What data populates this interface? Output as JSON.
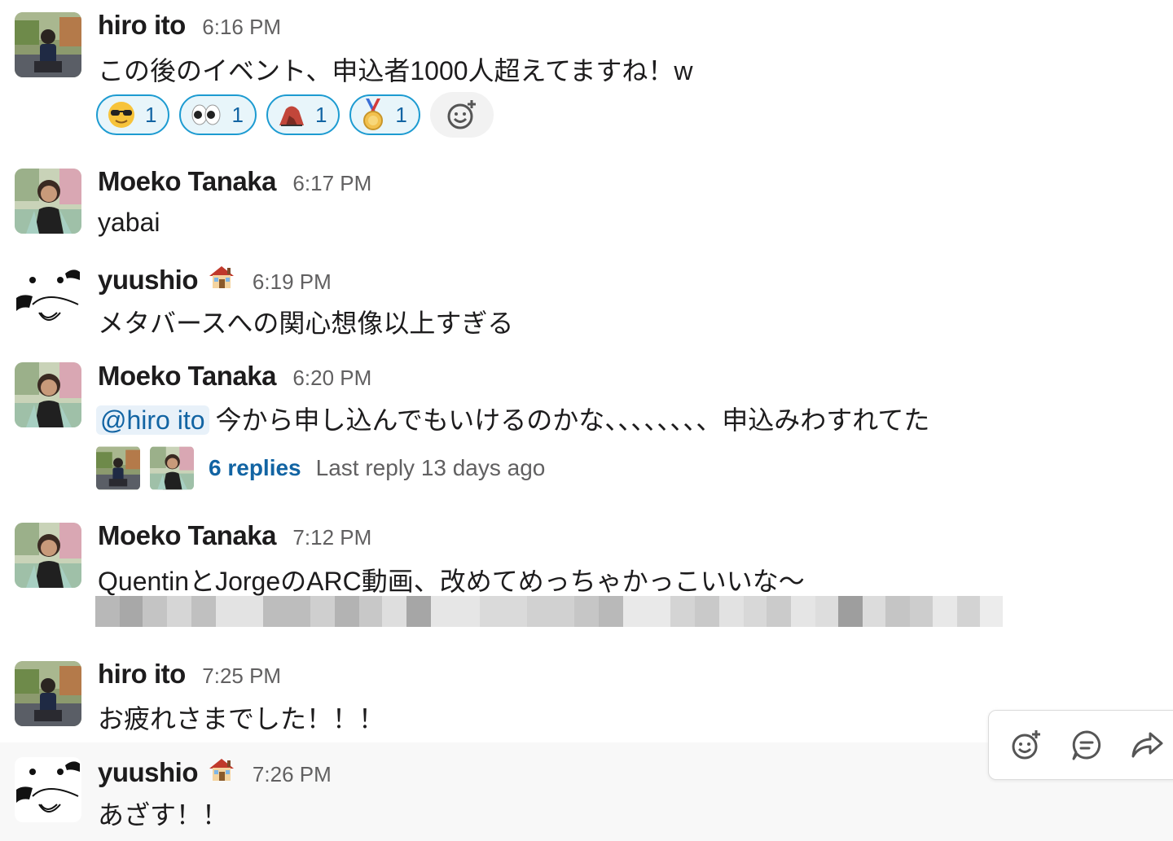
{
  "messages": [
    {
      "author": "hiro ito",
      "time": "6:16 PM",
      "text": "この後のイベント、申込者1000人超えてますね！w",
      "reactions": [
        {
          "emoji": "sunglasses-face",
          "count": "1"
        },
        {
          "emoji": "eyes",
          "count": "1"
        },
        {
          "emoji": "fire-stone",
          "count": "1"
        },
        {
          "emoji": "medal",
          "count": "1"
        }
      ]
    },
    {
      "author": "Moeko Tanaka",
      "time": "6:17 PM",
      "text": "yabai"
    },
    {
      "author": "yuushio",
      "status_emoji": "house-icon",
      "time": "6:19 PM",
      "text": "メタバースへの関心想像以上すぎる"
    },
    {
      "author": "Moeko Tanaka",
      "time": "6:20 PM",
      "mention": "@hiro ito",
      "text": "今から申し込んでもいけるのかな、、、、、、、、申込みわすれてた",
      "thread": {
        "replies": "6 replies",
        "last_reply": "Last reply 13 days ago"
      }
    },
    {
      "author": "Moeko Tanaka",
      "time": "7:12 PM",
      "text": "QuentinとJorgeのARC動画、改めてめっちゃかっこいいな〜"
    },
    {
      "author": "hiro ito",
      "time": "7:25 PM",
      "text": "お疲れさまでした！！！"
    },
    {
      "author": "yuushio",
      "status_emoji": "house-icon",
      "time": "7:26 PM",
      "text": "あざす！！"
    }
  ],
  "colors": {
    "link": "#1264a3",
    "reaction_border": "#1d9bd1",
    "reaction_bg": "#e8f5fa",
    "timestamp": "#616061",
    "hover_bg": "#f8f8f8"
  },
  "toolbar": {
    "icons": [
      "add-reaction-icon",
      "reply-thread-icon",
      "share-icon"
    ]
  }
}
